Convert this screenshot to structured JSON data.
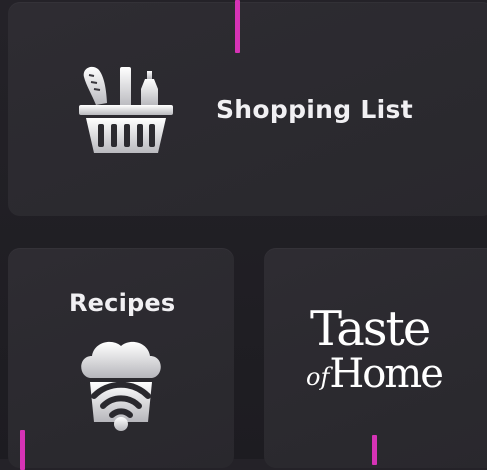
{
  "tiles": {
    "shopping": {
      "label": "Shopping List",
      "icon": "shopping-basket-icon"
    },
    "recipes": {
      "label": "Recipes",
      "icon": "chef-hat-wifi-icon"
    },
    "taste_of_home": {
      "logo_line1": "Taste",
      "logo_of": "of",
      "logo_home": "Home"
    }
  },
  "colors": {
    "accent": "#d633b5",
    "tile_bg": "#2b2a2f",
    "page_bg": "#1f1e23",
    "text": "#f1f0f3"
  }
}
